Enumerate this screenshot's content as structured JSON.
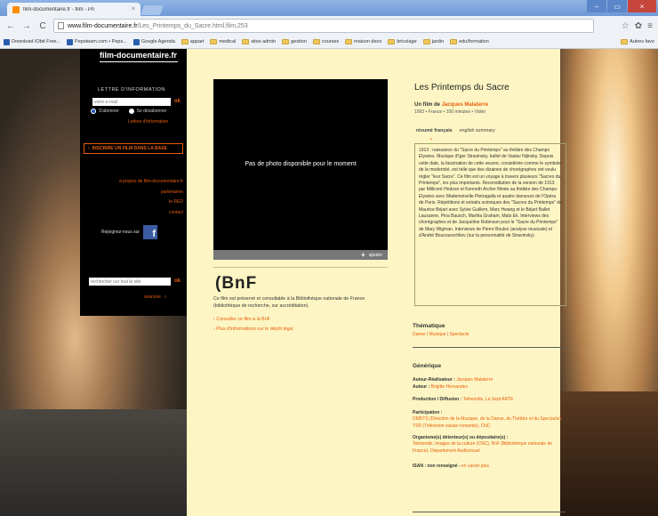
{
  "browser": {
    "tab_title": "film-documentaire.fr - film - Pri",
    "url_host": "www.film-documentaire.fr",
    "url_path": "/Les_Printemps_du_Sacre.html,film,253",
    "bookmarks": [
      {
        "label": "Download IObit Free...",
        "type": "app"
      },
      {
        "label": "Pepsteam.com • Peps...",
        "type": "app"
      },
      {
        "label": "Google Agenda",
        "type": "app"
      },
      {
        "label": "appart",
        "type": "folder"
      },
      {
        "label": "medical",
        "type": "folder"
      },
      {
        "label": "sites admin",
        "type": "folder"
      },
      {
        "label": "gestion",
        "type": "folder"
      },
      {
        "label": "courses",
        "type": "folder"
      },
      {
        "label": "maison deco",
        "type": "folder"
      },
      {
        "label": "bricolage",
        "type": "folder"
      },
      {
        "label": "jardin",
        "type": "folder"
      },
      {
        "label": "edu/formation",
        "type": "folder"
      },
      {
        "label": "Autres favo",
        "type": "folder"
      }
    ]
  },
  "sidebar": {
    "logo": "film-documentaire.fr",
    "newsletter_title": "LETTRE D'INFORMATION",
    "email_placeholder": "votre e-mail",
    "ok_label": "ok",
    "subscribe_label": "S'abonner",
    "unsubscribe_label": "Se désabonner",
    "newsletter_info": "Lettres d'information",
    "add_film_label": "INSCRIRE UN FILM DANS LA BASE",
    "links": [
      "à propos de film-documentaire.fr",
      "partenaires",
      "le RED",
      "contact"
    ],
    "facebook_text": "Rejoignez-nous sur",
    "search_placeholder": "rechercher sur tout le site",
    "advanced_label": "avancée"
  },
  "photo": {
    "message": "Pas de photo disponible pour le moment",
    "add_label": "ajouter"
  },
  "bnf": {
    "logo": "(BnF",
    "description": "Ce film est préservé et consultable à la Bibliothèque nationale de France (bibliothèque de recherche, sur accréditation).",
    "link1": "Consulter ce film à la BnF",
    "link2": "Plus d'informations sur le dépôt légal"
  },
  "film": {
    "title": "Les Printemps du Sacre",
    "by_prefix": "Un film de",
    "director": "Jacques Malaterre",
    "meta": "1993 • France • 100 minutes • Vidéo",
    "tab_fr": "résumé français",
    "tab_en": "english summary",
    "summary": "1913 : naissance du \"Sacre du Printemps\" au théâtre des Champs Elysées. Musique d'Igor Stravinsky, ballet de Vaslav Nijinsky. Depuis cette date, la fascination de cette oeuvre, considérée comme le symbole de la modernité, est telle que des dizaines de chorégraphes ont voulu régler \"leur Sacre\". Ce film est un voyage à travers plusieurs \"Sacres du Printemps\", les plus importants. Reconstitution de la version de 1913 par Millicent Hodson et Kenneth Archer filmée au théâtre des Champs-Elysées avec Mademoiselle Pietragalla et quatre danseurs de l'Opéra de Paris. Répétitions et extraits scéniques des \"Sacres du Printemps\" de Maurice Béjart avec Sylvie Guillem, Marc Hwang et le Béjart Ballet Lausanne, Pina Bausch, Martha Graham, Mats Ek. Interviews des chorégraphes et de Jacqueline Robinson pour le \"Sacre du Printemps\" de Mary Wigman. Interviews de Pierre Boulez (analyse musicale) et d'André Boucourechliev (sur la personnalité de Stravinsky)."
  },
  "thematique": {
    "title": "Thématique",
    "items": "Danse | Musique | Spectacle"
  },
  "generique": {
    "title": "Générique",
    "author_label": "Auteur-Réalisateur :",
    "author_value": "Jacques Malaterre",
    "auteur_label": "Auteur :",
    "auteur_value": "Brigitte Hernandez",
    "prod_label": "Production / Diffusion :",
    "prod_value": "Telmondis, La Sept ARTE",
    "participation_label": "Participation :",
    "participation_value": "DMDTS (Direction de la Musique, de la Danse, du Théâtre et du Spectacle), TSR (Télévision suisse romande), CNC",
    "org_label": "Organisme(s) détenteur(s) ou dépositaire(s) :",
    "org_value": "Telmondis, Images de la culture (CNC), BnF (Bibliothèque nationale de France), Département Audiovisuel",
    "isan_label": "ISAN : non renseigné -",
    "isan_link": "en savoir plus"
  }
}
